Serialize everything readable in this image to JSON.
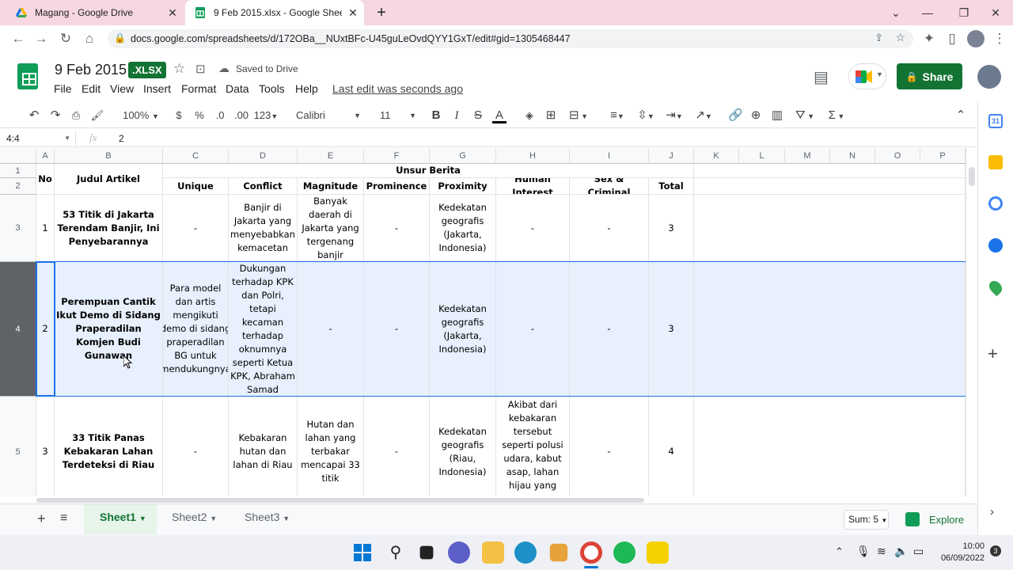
{
  "browser": {
    "tabs": [
      {
        "title": "Magang - Google Drive"
      },
      {
        "title": "9 Feb 2015.xlsx - Google Sheets"
      }
    ],
    "url": "docs.google.com/spreadsheets/d/172OBa__NUxtBFc-U45guLeOvdQYY1GxT/edit#gid=1305468447"
  },
  "doc": {
    "title": "9 Feb 2015",
    "badge": ".XLSX",
    "saved": "Saved to Drive",
    "last_edit": "Last edit was seconds ago",
    "share": "Share"
  },
  "menu": [
    "File",
    "Edit",
    "View",
    "Insert",
    "Format",
    "Data",
    "Tools",
    "Help"
  ],
  "toolbar": {
    "zoom": "100%",
    "currency": "$",
    "percent": "%",
    "dec_less": ".0",
    "dec_more": ".00",
    "number_format": "123",
    "font": "Calibri",
    "size": "11",
    "bold": "B",
    "italic": "I",
    "strike": "S",
    "text_color": "A"
  },
  "formula": {
    "name_box": "4:4",
    "fx": "fx",
    "value": "2"
  },
  "columns": [
    "A",
    "B",
    "C",
    "D",
    "E",
    "F",
    "G",
    "H",
    "I",
    "J",
    "K",
    "L",
    "M",
    "N",
    "O",
    "P"
  ],
  "rows": [
    "1",
    "2",
    "3",
    "4",
    "5"
  ],
  "headers": {
    "no": "No",
    "judul": "Judul Artikel",
    "unsur": "Unsur Berita",
    "sub": [
      "Unique",
      "Conflict",
      "Magnitude",
      "Prominence",
      "Proximity",
      "Human Interest",
      "Sex & Criminal",
      "Total"
    ]
  },
  "data_rows": [
    {
      "no": "1",
      "judul": "53 Titik di Jakarta Terendam Banjir, Ini Penyebarannya",
      "cells": [
        "-",
        "Banjir di Jakarta yang menyebabkan kemacetan",
        "Banyak daerah di Jakarta yang tergenang banjir",
        "-",
        "Kedekatan geografis (Jakarta, Indonesia)",
        "-",
        "-",
        "3"
      ]
    },
    {
      "no": "2",
      "judul": "Perempuan Cantik Ikut Demo di Sidang Praperadilan Komjen Budi Gunawan",
      "cells": [
        "Para model dan artis mengikuti demo di sidang praperadilan BG untuk mendukungnya",
        "Dukungan terhadap KPK dan Polri, tetapi kecaman terhadap oknumnya seperti Ketua KPK, Abraham Samad",
        "-",
        "-",
        "Kedekatan geografis (Jakarta, Indonesia)",
        "-",
        "-",
        "3"
      ]
    },
    {
      "no": "3",
      "judul": "33 Titik Panas Kebakaran Lahan Terdeteksi di Riau",
      "cells": [
        "-",
        "Kebakaran hutan dan lahan di Riau",
        "Hutan dan lahan yang terbakar mencapai 33 titik",
        "-",
        "Kedekatan geografis (Riau, Indonesia)",
        "Akibat dari kebakaran tersebut seperti polusi udara, kabut asap, lahan hijau yang",
        "-",
        "4"
      ]
    }
  ],
  "sheets": [
    "Sheet1",
    "Sheet2",
    "Sheet3"
  ],
  "status": {
    "sum": "Sum: 5",
    "explore": "Explore"
  },
  "clock": {
    "time": "10:00",
    "date": "06/09/2022"
  },
  "colors": {
    "green": "#137333",
    "selection": "#e8f0fe",
    "select_border": "#1a73e8",
    "tab_bar": "#f7d7e1"
  }
}
